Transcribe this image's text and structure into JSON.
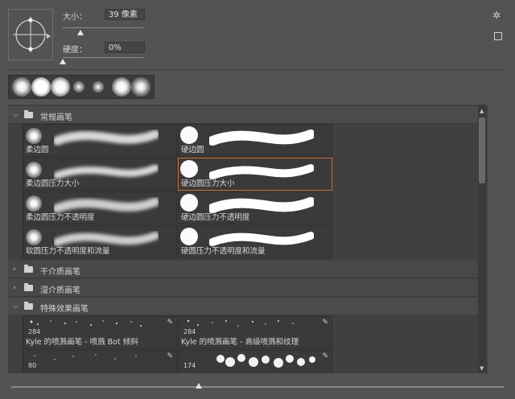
{
  "brush_settings": {
    "size_label": "大小：",
    "size_value": "39 像素",
    "hardness_label": "硬度：",
    "hardness_value": "0%",
    "size_slider_level": 0.22,
    "hardness_slider_level": 0.0
  },
  "presets": [
    {
      "icon": "soft-brush-icon"
    },
    {
      "icon": "soft-brush-icon"
    },
    {
      "icon": "soft-brush-icon"
    },
    {
      "icon": "soft-brush-icon"
    },
    {
      "icon": "soft-brush-icon"
    },
    {
      "icon": "soft-brush-icon"
    },
    {
      "icon": "soft-brush-icon"
    }
  ],
  "groups": [
    {
      "name": "常规画笔",
      "expanded": true,
      "brushes": [
        {
          "name": "柔边圆",
          "type": "soft"
        },
        {
          "name": "硬边圆",
          "type": "hard"
        },
        {
          "name": "柔边圆压力大小",
          "type": "soft"
        },
        {
          "name": "硬边圆压力大小",
          "type": "hard",
          "selected": true
        },
        {
          "name": "柔边圆压力不透明度",
          "type": "soft"
        },
        {
          "name": "硬边圆压力不透明度",
          "type": "hard"
        },
        {
          "name": "软圆压力不透明度和流量",
          "type": "soft"
        },
        {
          "name": "硬圆压力不透明度和流量",
          "type": "hard"
        }
      ]
    },
    {
      "name": "干介质画笔",
      "expanded": false
    },
    {
      "name": "湿介质画笔",
      "expanded": false
    },
    {
      "name": "特殊效果画笔",
      "expanded": true,
      "brushes": [
        {
          "name": "Kyle 的喷溅画笔 - 喷溅 Bot 倾斜",
          "count": "284"
        },
        {
          "name": "Kyle 的喷溅画笔 - 高级喷溅和纹理",
          "count": "284"
        },
        {
          "name": "",
          "count": "80"
        },
        {
          "name": "",
          "count": "174"
        }
      ]
    }
  ],
  "preview_zoom_level": 0.38,
  "colors": {
    "selection": "#c46a2e",
    "panel": "#535353"
  }
}
